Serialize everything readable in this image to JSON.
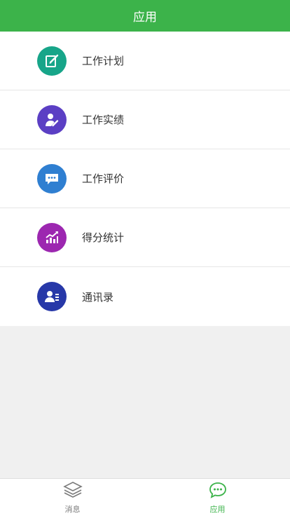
{
  "header": {
    "title": "应用"
  },
  "menu": {
    "items": [
      {
        "label": "工作计划",
        "icon": "edit-note-icon",
        "color": "#17a589"
      },
      {
        "label": "工作实绩",
        "icon": "user-edit-icon",
        "color": "#5b3fc4"
      },
      {
        "label": "工作评价",
        "icon": "chat-bubble-icon",
        "color": "#2f7fd1"
      },
      {
        "label": "得分统计",
        "icon": "bar-chart-icon",
        "color": "#9c27b0"
      },
      {
        "label": "通讯录",
        "icon": "contacts-icon",
        "color": "#2738a8"
      }
    ]
  },
  "tabbar": {
    "tabs": [
      {
        "label": "消息",
        "icon": "layers-icon"
      },
      {
        "label": "应用",
        "icon": "chat-bubble-icon"
      }
    ]
  },
  "colors": {
    "accent": "#3cb34a",
    "background": "#f0f0f0"
  }
}
